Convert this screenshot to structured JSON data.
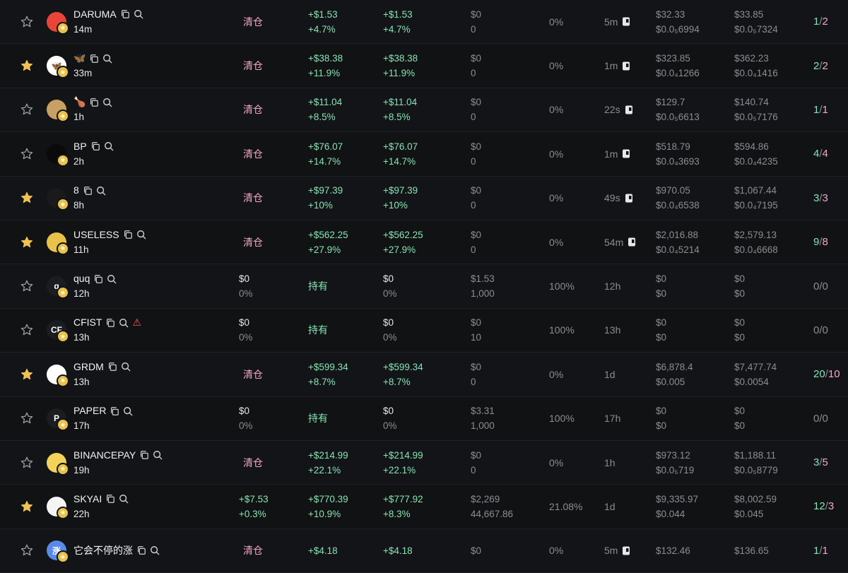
{
  "rows": [
    {
      "starred": false,
      "avatar": {
        "text": "",
        "bg": "#e8443a"
      },
      "name": "DARUMA",
      "extra": "",
      "age": "14m",
      "sold": {
        "status": "清仓"
      },
      "realized": [
        "+$1.53",
        "+4.7%"
      ],
      "total": [
        "+$1.53",
        "+4.7%"
      ],
      "remain": [
        "$0",
        "0"
      ],
      "pct": "0%",
      "dur": "5m",
      "dur_icon": true,
      "buy": [
        "$32.33",
        "$0.0₅6994"
      ],
      "sell": [
        "$33.85",
        "$0.0₅7324"
      ],
      "tx_buy": "1",
      "tx_sell": "2"
    },
    {
      "starred": true,
      "avatar": {
        "text": "🦋",
        "bg": "#ffffff"
      },
      "name": "🦋",
      "extra": "",
      "age": "33m",
      "sold": {
        "status": "清仓"
      },
      "realized": [
        "+$38.38",
        "+11.9%"
      ],
      "total": [
        "+$38.38",
        "+11.9%"
      ],
      "remain": [
        "$0",
        "0"
      ],
      "pct": "0%",
      "dur": "1m",
      "dur_icon": true,
      "buy": [
        "$323.85",
        "$0.0₄1266"
      ],
      "sell": [
        "$362.23",
        "$0.0₄1416"
      ],
      "tx_buy": "2",
      "tx_sell": "2"
    },
    {
      "starred": false,
      "avatar": {
        "text": "",
        "bg": "#c8a064"
      },
      "name": "🍗",
      "extra": "",
      "age": "1h",
      "sold": {
        "status": "清仓"
      },
      "realized": [
        "+$11.04",
        "+8.5%"
      ],
      "total": [
        "+$11.04",
        "+8.5%"
      ],
      "remain": [
        "$0",
        "0"
      ],
      "pct": "0%",
      "dur": "22s",
      "dur_icon": true,
      "buy": [
        "$129.7",
        "$0.0₅6613"
      ],
      "sell": [
        "$140.74",
        "$0.0₅7176"
      ],
      "tx_buy": "1",
      "tx_sell": "1"
    },
    {
      "starred": false,
      "avatar": {
        "text": "",
        "bg": "#0a0a0a"
      },
      "name": "BP",
      "extra": "",
      "age": "2h",
      "sold": {
        "status": "清仓"
      },
      "realized": [
        "+$76.07",
        "+14.7%"
      ],
      "total": [
        "+$76.07",
        "+14.7%"
      ],
      "remain": [
        "$0",
        "0"
      ],
      "pct": "0%",
      "dur": "1m",
      "dur_icon": true,
      "buy": [
        "$518.79",
        "$0.0₄3693"
      ],
      "sell": [
        "$594.86",
        "$0.0₄4235"
      ],
      "tx_buy": "4",
      "tx_sell": "4"
    },
    {
      "starred": true,
      "avatar": {
        "text": "",
        "bg": "#1a1a1a"
      },
      "name": "8",
      "extra": "",
      "age": "8h",
      "sold": {
        "status": "清仓"
      },
      "realized": [
        "+$97.39",
        "+10%"
      ],
      "total": [
        "+$97.39",
        "+10%"
      ],
      "remain": [
        "$0",
        "0"
      ],
      "pct": "0%",
      "dur": "49s",
      "dur_icon": true,
      "buy": [
        "$970.05",
        "$0.0₄6538"
      ],
      "sell": [
        "$1,067.44",
        "$0.0₄7195"
      ],
      "tx_buy": "3",
      "tx_sell": "3"
    },
    {
      "starred": true,
      "avatar": {
        "text": "",
        "bg": "#e8c24a"
      },
      "name": "USELESS",
      "extra": "",
      "age": "11h",
      "sold": {
        "status": "清仓"
      },
      "realized": [
        "+$562.25",
        "+27.9%"
      ],
      "total": [
        "+$562.25",
        "+27.9%"
      ],
      "remain": [
        "$0",
        "0"
      ],
      "pct": "0%",
      "dur": "54m",
      "dur_icon": true,
      "buy": [
        "$2,016.88",
        "$0.0₄5214"
      ],
      "sell": [
        "$2,579.13",
        "$0.0₄6668"
      ],
      "tx_buy": "9",
      "tx_sell": "8"
    },
    {
      "starred": false,
      "avatar": {
        "text": "q",
        "bg": "#1c1d21"
      },
      "name": "quq",
      "extra": "",
      "age": "12h",
      "sold": {
        "value": [
          "$0",
          "0%"
        ]
      },
      "realized": [
        "持有"
      ],
      "total": [
        "$0",
        "0%"
      ],
      "remain": [
        "$1.53",
        "1,000"
      ],
      "pct": "100%",
      "dur": "12h",
      "dur_icon": false,
      "buy": [
        "$0",
        "$0"
      ],
      "sell": [
        "$0",
        "$0"
      ],
      "tx_buy": "0",
      "tx_sell": "0"
    },
    {
      "starred": false,
      "avatar": {
        "text": "CF",
        "bg": "#1c1d21"
      },
      "name": "CFIST",
      "extra": "warn",
      "age": "13h",
      "sold": {
        "value": [
          "$0",
          "0%"
        ]
      },
      "realized": [
        "持有"
      ],
      "total": [
        "$0",
        "0%"
      ],
      "remain": [
        "$0",
        "10"
      ],
      "pct": "100%",
      "dur": "13h",
      "dur_icon": false,
      "buy": [
        "$0",
        "$0"
      ],
      "sell": [
        "$0",
        "$0"
      ],
      "tx_buy": "0",
      "tx_sell": "0"
    },
    {
      "starred": true,
      "avatar": {
        "text": "",
        "bg": "#ffffff"
      },
      "name": "GRDM",
      "extra": "",
      "age": "13h",
      "sold": {
        "status": "清仓"
      },
      "realized": [
        "+$599.34",
        "+8.7%"
      ],
      "total": [
        "+$599.34",
        "+8.7%"
      ],
      "remain": [
        "$0",
        "0"
      ],
      "pct": "0%",
      "dur": "1d",
      "dur_icon": false,
      "buy": [
        "$6,878.4",
        "$0.005"
      ],
      "sell": [
        "$7,477.74",
        "$0.0054"
      ],
      "tx_buy": "20",
      "tx_sell": "10"
    },
    {
      "starred": false,
      "avatar": {
        "text": "P",
        "bg": "#1c1d21"
      },
      "name": "PAPER",
      "extra": "",
      "age": "17h",
      "sold": {
        "value": [
          "$0",
          "0%"
        ]
      },
      "realized": [
        "持有"
      ],
      "total": [
        "$0",
        "0%"
      ],
      "remain": [
        "$3.31",
        "1,000"
      ],
      "pct": "100%",
      "dur": "17h",
      "dur_icon": false,
      "buy": [
        "$0",
        "$0"
      ],
      "sell": [
        "$0",
        "$0"
      ],
      "tx_buy": "0",
      "tx_sell": "0"
    },
    {
      "starred": false,
      "avatar": {
        "text": "",
        "bg": "#f2d35a"
      },
      "name": "BINANCEPAY",
      "extra": "",
      "age": "19h",
      "sold": {
        "status": "清仓"
      },
      "realized": [
        "+$214.99",
        "+22.1%"
      ],
      "total": [
        "+$214.99",
        "+22.1%"
      ],
      "remain": [
        "$0",
        "0"
      ],
      "pct": "0%",
      "dur": "1h",
      "dur_icon": false,
      "buy": [
        "$973.12",
        "$0.0₅719"
      ],
      "sell": [
        "$1,188.11",
        "$0.0₅8779"
      ],
      "tx_buy": "3",
      "tx_sell": "5"
    },
    {
      "starred": true,
      "avatar": {
        "text": "",
        "bg": "#f5f5f5"
      },
      "name": "SKYAI",
      "extra": "",
      "age": "22h",
      "sold": {
        "value": [
          "+$7.53",
          "+0.3%"
        ],
        "green": true
      },
      "realized": [
        "+$770.39",
        "+10.9%"
      ],
      "total": [
        "+$777.92",
        "+8.3%"
      ],
      "remain": [
        "$2,269",
        "44,667.86"
      ],
      "pct": "21.08%",
      "dur": "1d",
      "dur_icon": false,
      "buy": [
        "$9,335.97",
        "$0.044"
      ],
      "sell": [
        "$8,002.59",
        "$0.045"
      ],
      "tx_buy": "12",
      "tx_sell": "3"
    },
    {
      "starred": false,
      "avatar": {
        "text": "涨",
        "bg": "#5a8ae8"
      },
      "name": "它会不停的涨",
      "extra": "",
      "age": "",
      "sold": {
        "status": "清仓"
      },
      "realized": [
        "+$4.18",
        ""
      ],
      "total": [
        "+$4.18",
        ""
      ],
      "remain": [
        "$0",
        ""
      ],
      "pct": "0%",
      "dur": "5m",
      "dur_icon": true,
      "buy": [
        "$132.46",
        ""
      ],
      "sell": [
        "$136.65",
        ""
      ],
      "tx_buy": "1",
      "tx_sell": "1"
    }
  ],
  "colors": {
    "green": "#86e3b3",
    "gray": "#8a8d94",
    "pink": "#f3a8c4",
    "star": "#f0c350"
  }
}
